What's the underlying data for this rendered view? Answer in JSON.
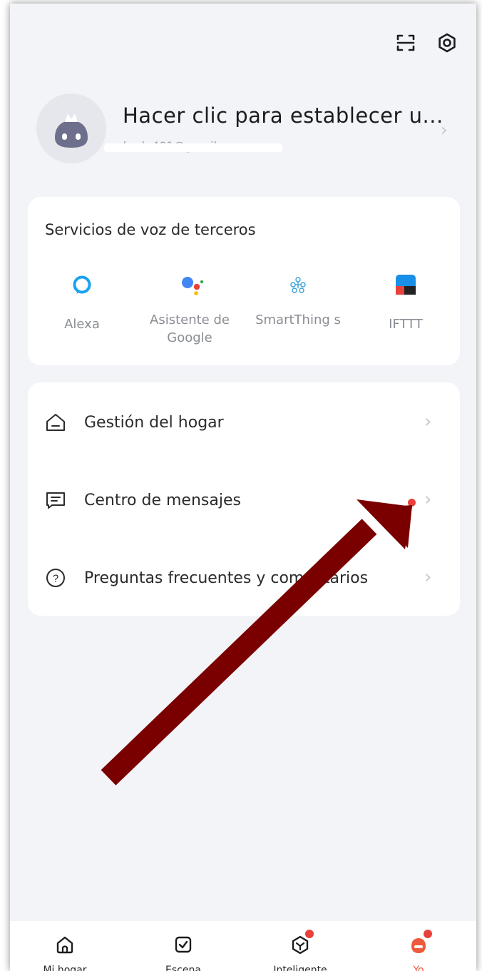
{
  "header": {
    "scan_icon": "scan-icon",
    "settings_icon": "settings-icon"
  },
  "profile": {
    "name": "Hacer clic para establecer u...",
    "email": "chadn401@gmail.com"
  },
  "voice_services": {
    "title": "Servicios de voz de terceros",
    "items": [
      {
        "label": "Alexa",
        "icon": "alexa-icon"
      },
      {
        "label": "Asistente de Google",
        "icon": "google-assistant-icon"
      },
      {
        "label": "SmartThing s",
        "icon": "smartthings-icon"
      },
      {
        "label": "IFTTT",
        "icon": "ifttt-icon"
      }
    ]
  },
  "menu": {
    "items": [
      {
        "label": "Gestión del hogar",
        "icon": "home-icon",
        "has_dot": false
      },
      {
        "label": "Centro de mensajes",
        "icon": "message-icon",
        "has_dot": true
      },
      {
        "label": "Preguntas frecuentes y comentarios",
        "icon": "help-icon",
        "has_dot": false
      }
    ]
  },
  "tabbar": {
    "tabs": [
      {
        "label": "Mi hogar",
        "icon": "home-tab-icon",
        "active": false
      },
      {
        "label": "Escena",
        "icon": "scene-tab-icon",
        "active": false
      },
      {
        "label": "Inteligente",
        "icon": "smart-tab-icon",
        "active": false,
        "badge": true
      },
      {
        "label": "Yo",
        "icon": "profile-tab-icon",
        "active": true,
        "badge": true
      }
    ]
  },
  "colors": {
    "background": "#f3f4f8",
    "card": "#ffffff",
    "accent": "#ef5a3c",
    "badge": "#e8413b",
    "annotation_arrow": "#7a0000"
  }
}
